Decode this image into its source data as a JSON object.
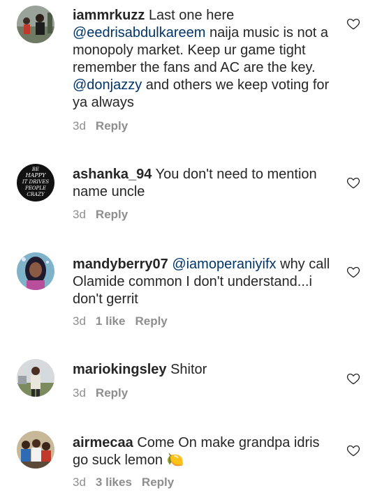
{
  "comments": [
    {
      "username": "iammrkuzz",
      "segments": [
        {
          "t": "Last one here "
        },
        {
          "t": "@eedrisabdulkareem",
          "m": true
        },
        {
          "t": " naija music is not a monopoly market. Keep ur game tight remember the fans and AC are the key. "
        },
        {
          "t": "@donjazzy",
          "m": true
        },
        {
          "t": " and others we keep voting for ya always"
        }
      ],
      "time": "3d",
      "likes": "",
      "reply": "Reply"
    },
    {
      "username": "ashanka_94",
      "segments": [
        {
          "t": "You don't need to mention name uncle"
        }
      ],
      "time": "3d",
      "likes": "",
      "reply": "Reply",
      "avatar_text": [
        "BE",
        "HAPPY",
        "IT DRIVES",
        "PEOPLE",
        "CRAZY"
      ]
    },
    {
      "username": "mandyberry07",
      "segments": [
        {
          "t": "@iamoperaniyifx",
          "m": true
        },
        {
          "t": " why call Olamide common I don't understand...i don't gerrit"
        }
      ],
      "time": "3d",
      "likes": "1 like",
      "reply": "Reply"
    },
    {
      "username": "mariokingsley",
      "segments": [
        {
          "t": "Shitor"
        }
      ],
      "time": "3d",
      "likes": "",
      "reply": "Reply"
    },
    {
      "username": "airmecaa",
      "segments": [
        {
          "t": "Come On make grandpa idris go suck lemon 🍋"
        }
      ],
      "time": "3d",
      "likes": "3 likes",
      "reply": "Reply"
    }
  ],
  "colors": {
    "text": "#262626",
    "mention": "#003569",
    "meta": "#8e8e8e"
  },
  "icons": {
    "like": "heart-outline-icon"
  }
}
